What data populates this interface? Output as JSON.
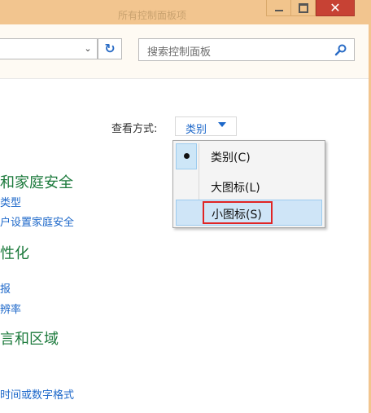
{
  "window": {
    "title": "所有控制面板项",
    "minimize_label": "",
    "maximize_label": "",
    "close_label": "✕"
  },
  "toolbar": {
    "search_placeholder": "搜索控制面板"
  },
  "view": {
    "label": "查看方式:",
    "selected": "类别"
  },
  "menu": {
    "items": [
      {
        "label": "类别(C)",
        "checked": true
      },
      {
        "label": "大图标(L)",
        "checked": false
      },
      {
        "label": "小图标(S)",
        "checked": false,
        "hover": true,
        "highlighted": true
      }
    ]
  },
  "categories": [
    {
      "heading": "和家庭安全",
      "links": [
        "类型",
        "户设置家庭安全"
      ]
    },
    {
      "heading": "性化",
      "links": [
        "报",
        "辨率"
      ]
    },
    {
      "heading": "言和区域",
      "links": [
        "时间或数字格式"
      ]
    }
  ],
  "colors": {
    "titlebar": "#f2c58f",
    "close_button": "#c74234",
    "link": "#1c67c9",
    "heading": "#1c7a3c",
    "highlight": "#e02424"
  }
}
